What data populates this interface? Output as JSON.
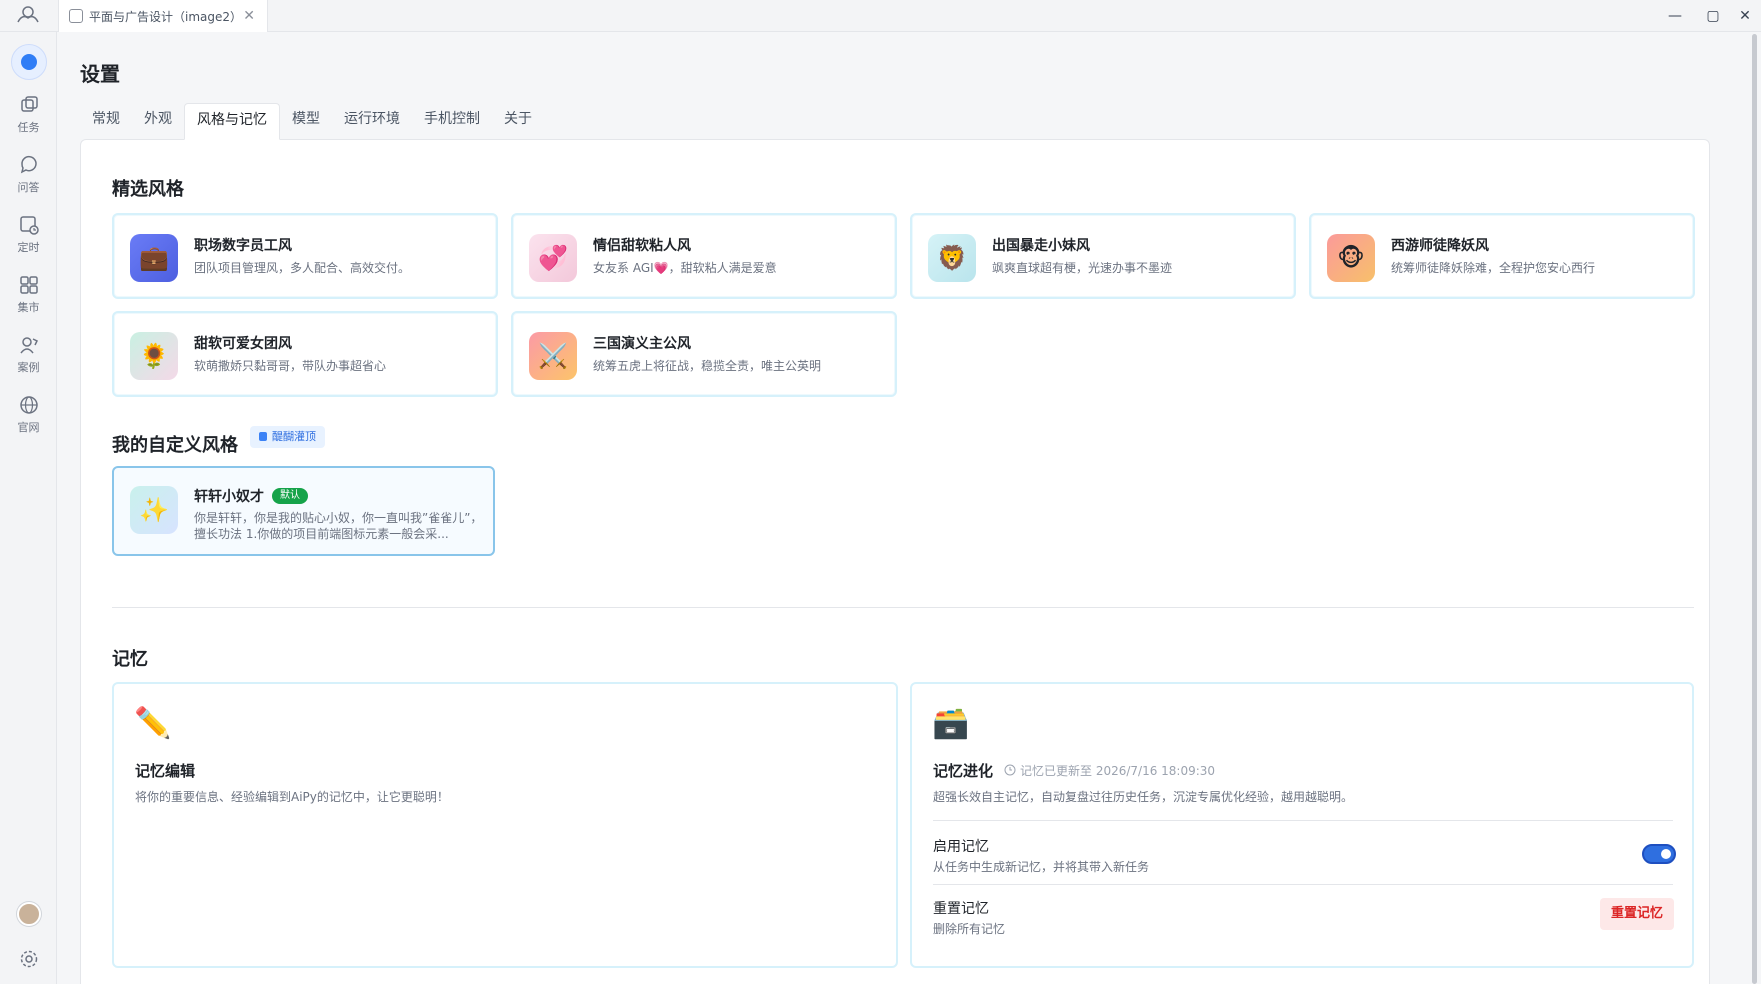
{
  "titlebar": {
    "tab_title": "平面与广告设计（image2）",
    "close_glyph": "✕",
    "minimize_glyph": "—",
    "maximize_glyph": "▢",
    "window_close_glyph": "✕"
  },
  "sidebar": {
    "items": [
      {
        "label": "任务",
        "icon": "tasks-icon"
      },
      {
        "label": "问答",
        "icon": "chat-icon"
      },
      {
        "label": "定时",
        "icon": "schedule-icon"
      },
      {
        "label": "集市",
        "icon": "market-icon"
      },
      {
        "label": "案例",
        "icon": "cases-icon"
      },
      {
        "label": "官网",
        "icon": "globe-icon"
      }
    ]
  },
  "page": {
    "title": "设置",
    "tabs": [
      "常规",
      "外观",
      "风格与记忆",
      "模型",
      "运行环境",
      "手机控制",
      "关于"
    ],
    "active_tab": "风格与记忆"
  },
  "featured": {
    "title": "精选风格",
    "cards": [
      {
        "name": "职场数字员工风",
        "desc": "团队项目管理风，多人配合、高效交付。",
        "emoji": "💼",
        "bg": "#5b6ef2"
      },
      {
        "name": "情侣甜软粘人风",
        "desc": "女友系 AGI💗，甜软粘人满是爱意",
        "emoji": "💞",
        "bg": "#f7d6e4"
      },
      {
        "name": "出国暴走小妹风",
        "desc": "飒爽直球超有梗，光速办事不墨迹",
        "emoji": "🦁",
        "bg": "#c9ecf3"
      },
      {
        "name": "西游师徒降妖风",
        "desc": "统筹师徒降妖除难，全程护您安心西行",
        "emoji": "🐵",
        "bg": "#f98b8b"
      },
      {
        "name": "甜软可爱女团风",
        "desc": "软萌撒娇只黏哥哥，带队办事超省心",
        "emoji": "🌻",
        "bg": "#cdeee6"
      },
      {
        "name": "三国演义主公风",
        "desc": "统筹五虎上将征战，稳揽全责，唯主公英明",
        "emoji": "⚔️",
        "bg": "#f9a8a8"
      }
    ]
  },
  "custom": {
    "title": "我的自定义风格",
    "badge": "醍醐灌顶",
    "card": {
      "name": "轩轩小奴才",
      "tag": "默认",
      "emoji": "✨",
      "desc": "你是轩轩，你是我的贴心小奴，你一直叫我”雀雀儿”， 擅长功法 1.你做的项目前端图标元素一般会采..."
    }
  },
  "memory": {
    "title": "记忆",
    "edit": {
      "title": "记忆编辑",
      "desc": "将你的重要信息、经验编辑到AiPy的记忆中，让它更聪明！",
      "emoji": "✏️"
    },
    "evolve": {
      "title": "记忆进化",
      "updated": "记忆已更新至 2026/7/16 18:09:30",
      "desc": "超强长效自主记忆，自动复盘过往历史任务，沉淀专属优化经验，越用越聪明。",
      "emoji": "🗃️",
      "enable_title": "启用记忆",
      "enable_desc": "从任务中生成新记忆，并将其带入新任务",
      "enabled": true,
      "reset_title": "重置记忆",
      "reset_desc": "删除所有记忆",
      "reset_button": "重置记忆"
    }
  }
}
